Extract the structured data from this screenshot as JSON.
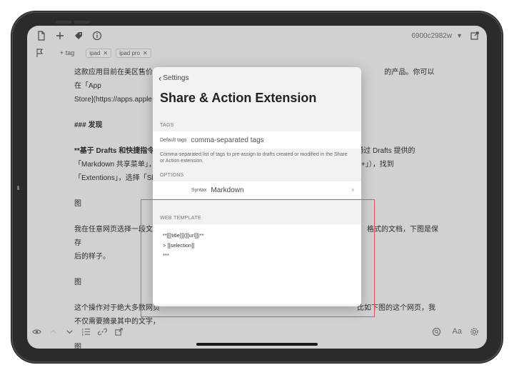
{
  "topbar": {
    "draft_id": "6900c2982w",
    "caret": "▼"
  },
  "tags": {
    "add_label": "+ tag",
    "chips": [
      "ipad",
      "ipad pro"
    ],
    "remove_glyph": "✕"
  },
  "editor": {
    "lines": [
      "这款应用目前在美区售价 4",
      "Store](https://apps.apple",
      "### 发现",
      "**基于 Drafts 和快捷指令的",
      "「Markdown 共享菜单」，",
      "「Extentions」，选择「Sh",
      "图",
      "我在任意网页选择一段文字",
      "后的样子。",
      "图",
      "这个操作对于绝大多数网页",
      "不仅需要摘录其中的文字，",
      "图"
    ],
    "right_fragments": {
      "line1": "的产品。你可以在「App",
      "line2": "。",
      "line4": "都会通过 Drafts 提供的",
      "line5": "mand+」），找到",
      "line8": "格式的文档，下图是保存",
      "line11": "比如下图的这个网页，我"
    }
  },
  "sheet": {
    "back_label": "Settings",
    "title": "Share & Action Extension",
    "tags_section": "TAGS",
    "default_tags_label": "Default tags",
    "default_tags_placeholder": "comma-separated tags",
    "helper_text": "Comma-separated list of tags to pre-assign to drafts created or modified in the Share or Action extension.",
    "options_section": "OPTIONS",
    "syntax_label": "Syntax",
    "syntax_value": "Markdown",
    "web_template_section": "WEB TEMPLATE",
    "template_lines": [
      "**[[[title]]]([[url]])**",
      "",
      "> [[selection]]",
      "***"
    ]
  },
  "bottombar": {
    "font_label": "Aa"
  },
  "colors": {
    "selection_outline": "#e3505a"
  }
}
